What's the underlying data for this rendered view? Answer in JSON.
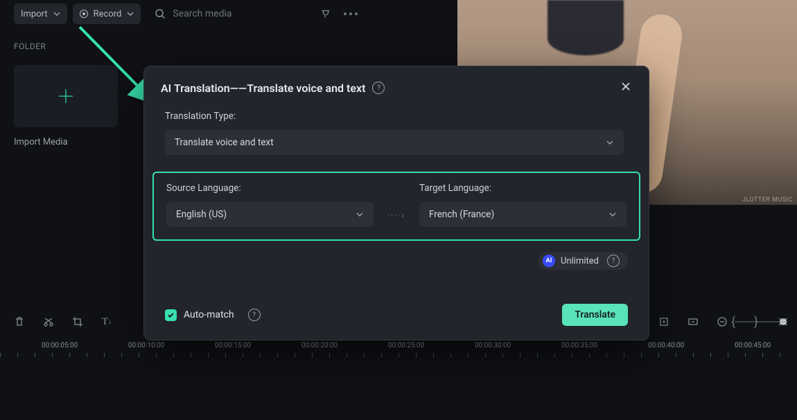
{
  "toolbar": {
    "import_label": "Import",
    "record_label": "Record",
    "search_placeholder": "Search media"
  },
  "left": {
    "folder_label": "FOLDER",
    "import_media_label": "Import Media"
  },
  "preview": {
    "watermark": "JLOTTER MUSIC"
  },
  "timeline": {
    "labels": [
      "00:00:05:00",
      "00:00:10:00",
      "00:00:15:00",
      "00:00:20:00",
      "00:00:25:00",
      "00:00:30:00",
      "00:00:35:00",
      "00:00:40:00",
      "00:00:45:00"
    ]
  },
  "modal": {
    "title": "AI Translation——Translate voice and text",
    "translation_type_label": "Translation Type:",
    "translation_type_value": "Translate voice and text",
    "source_label": "Source Language:",
    "source_value": "English (US)",
    "target_label": "Target Language:",
    "target_value": "French (France)",
    "unlimited_label": "Unlimited",
    "ai_badge": "AI",
    "automatch_label": "Auto-match",
    "translate_button": "Translate"
  }
}
